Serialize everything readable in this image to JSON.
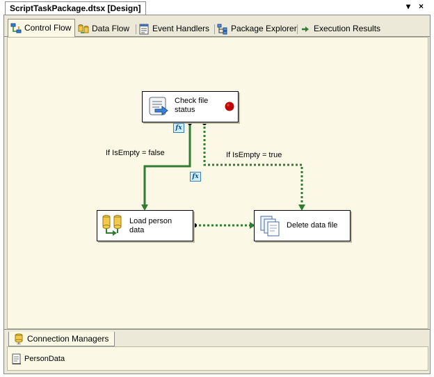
{
  "document": {
    "title": "ScriptTaskPackage.dtsx [Design]"
  },
  "window_buttons": {
    "dropdown": "▾",
    "close": "×"
  },
  "designer_tabs": [
    {
      "label": "Control Flow",
      "icon": "control-flow-icon",
      "active": true
    },
    {
      "label": "Data Flow",
      "icon": "data-flow-icon",
      "active": false
    },
    {
      "label": "Event Handlers",
      "icon": "event-handlers-icon",
      "active": false
    },
    {
      "label": "Package Explorer",
      "icon": "package-explorer-icon",
      "active": false
    },
    {
      "label": "Execution Results",
      "icon": "execution-results-icon",
      "active": false
    }
  ],
  "tasks": {
    "check_file": {
      "label_line1": "Check file",
      "label_line2": "status",
      "icon": "script-task-icon",
      "breakpoint": true
    },
    "load_person": {
      "label_line1": "Load person",
      "label_line2": "data",
      "icon": "data-flow-task-icon"
    },
    "delete_file": {
      "label": "Delete data file",
      "icon": "file-system-task-icon"
    }
  },
  "precedence": {
    "false_label": "If IsEmpty = false",
    "true_label": "If IsEmpty = true",
    "expression_badge": "fx"
  },
  "colors": {
    "success_line": "#2e7d32",
    "breakpoint": "#c00000",
    "canvas": "#fbf8e6"
  },
  "connection_managers": {
    "tab_label": "Connection Managers",
    "items": [
      {
        "label": "PersonData",
        "icon": "flat-file-connection-icon"
      }
    ]
  }
}
